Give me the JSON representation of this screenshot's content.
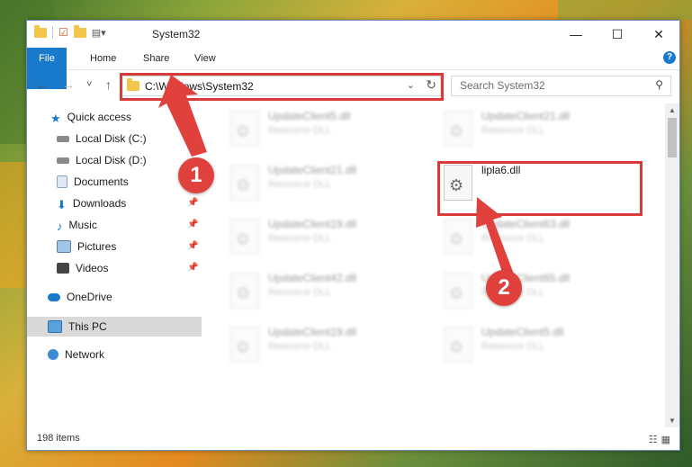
{
  "window": {
    "title": "System32",
    "controls": {
      "minimize": "—",
      "maximize": "☐",
      "close": "✕"
    }
  },
  "ribbon": {
    "tabs": [
      {
        "label": "File"
      },
      {
        "label": "Home"
      },
      {
        "label": "Share"
      },
      {
        "label": "View"
      }
    ],
    "help": "?"
  },
  "navigation": {
    "back": "←",
    "forward": "→",
    "recent": "˅",
    "up": "↑",
    "address": "C:\\Windows\\System32",
    "search_placeholder": "Search System32"
  },
  "sidebar": {
    "items": [
      {
        "label": "Quick access"
      },
      {
        "label": "Local Disk (C:)"
      },
      {
        "label": "Local Disk (D:)"
      },
      {
        "label": "Documents"
      },
      {
        "label": "Downloads"
      },
      {
        "label": "Music"
      },
      {
        "label": "Pictures"
      },
      {
        "label": "Videos"
      },
      {
        "label": "OneDrive"
      },
      {
        "label": "This PC"
      },
      {
        "label": "Network"
      }
    ]
  },
  "files": [
    {
      "name": "UpdateClient5.dll",
      "desc": "Resource DLL"
    },
    {
      "name": "UpdateClient21.dll",
      "desc": "Resource DLL"
    },
    {
      "name": "UpdateClient21.dll",
      "desc": "Resource DLL"
    },
    {
      "name": "lipla6.dll",
      "desc": ""
    },
    {
      "name": "UpdateClient19.dll",
      "desc": "Resource DLL"
    },
    {
      "name": "UpdateClient63.dll",
      "desc": "Resource DLL"
    },
    {
      "name": "UpdateClient42.dll",
      "desc": "Resource DLL"
    },
    {
      "name": "UpdateClient65.dll",
      "desc": "Resource DLL"
    },
    {
      "name": "UpdateClient19.dll",
      "desc": "Resource DLL"
    },
    {
      "name": "UpdateClient5.dll",
      "desc": "Resource DLL"
    }
  ],
  "status": {
    "item_count": "198 items"
  },
  "annotations": {
    "step1": "1",
    "step2": "2"
  },
  "colors": {
    "accent": "#1979ca",
    "highlight": "#d93a3a"
  }
}
